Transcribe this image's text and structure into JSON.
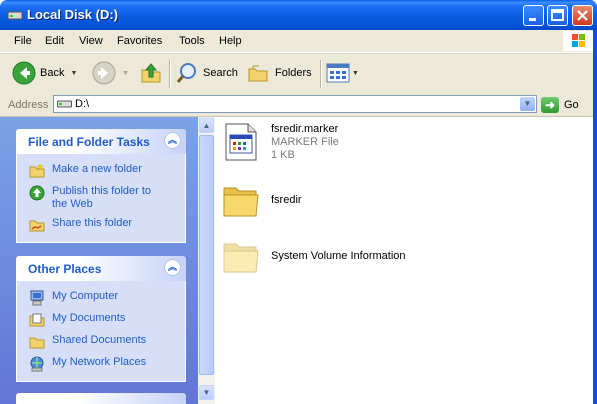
{
  "window": {
    "title": "Local Disk (D:)"
  },
  "menu": [
    "File",
    "Edit",
    "View",
    "Favorites",
    "Tools",
    "Help"
  ],
  "toolbar": {
    "back_label": "Back",
    "search_label": "Search",
    "folders_label": "Folders"
  },
  "address": {
    "label": "Address",
    "value": "D:\\",
    "go_label": "Go"
  },
  "file_tasks": {
    "title": "File and Folder Tasks",
    "items": [
      {
        "label": "Make a new folder",
        "icon": "new-folder-icon"
      },
      {
        "label": "Publish this folder to the Web",
        "icon": "publish-web-icon"
      },
      {
        "label": "Share this folder",
        "icon": "share-folder-icon"
      }
    ]
  },
  "other_places": {
    "title": "Other Places",
    "items": [
      {
        "label": "My Computer",
        "icon": "my-computer-icon"
      },
      {
        "label": "My Documents",
        "icon": "my-documents-icon"
      },
      {
        "label": "Shared Documents",
        "icon": "shared-documents-icon"
      },
      {
        "label": "My Network Places",
        "icon": "network-places-icon"
      }
    ]
  },
  "files": [
    {
      "name": "fsredir.marker",
      "type": "MARKER File",
      "size": "1 KB",
      "icon": "file-icon"
    },
    {
      "name": "fsredir",
      "icon": "folder-icon"
    },
    {
      "name": "System Volume Information",
      "icon": "hidden-folder-icon"
    }
  ]
}
